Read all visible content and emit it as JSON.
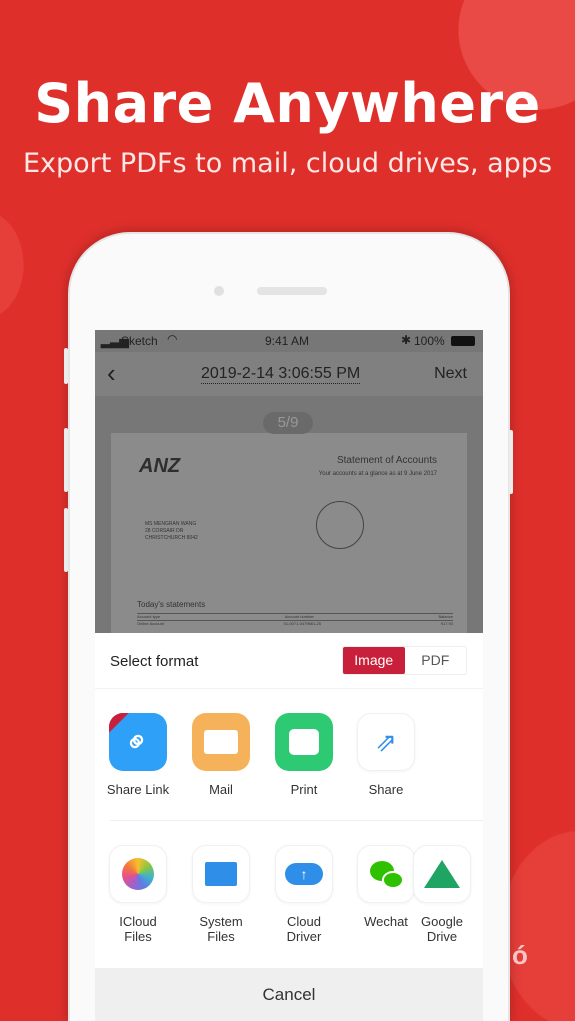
{
  "hero": {
    "title": "Share Anywhere",
    "subtitle": "Export PDFs to mail, cloud drives, apps"
  },
  "status_bar": {
    "carrier": "Sketch",
    "time": "9:41 AM",
    "battery": "100%"
  },
  "nav": {
    "title": "2019-2-14 3:06:55 PM",
    "next": "Next"
  },
  "pager": "5/9",
  "document": {
    "logo": "ANZ",
    "heading": "Statement of Accounts",
    "subheading": "Your accounts at a glance as at 9 June 2017",
    "address": [
      "MS MENGRAN WANG",
      "28 CORSAIR DR",
      "CHRISTCHURCH 8042"
    ],
    "section": "Today's statements",
    "columns": [
      "Account type",
      "Account number",
      "Balance"
    ],
    "row": [
      "Online Account",
      "01-0071-0479661-25",
      "917.93"
    ]
  },
  "sheet": {
    "format_label": "Select format",
    "formats": [
      "Image",
      "PDF"
    ],
    "selected_format": "Image",
    "row1": [
      {
        "label": "Share Link",
        "icon": "link-icon",
        "color": "#2ea0f8"
      },
      {
        "label": "Mail",
        "icon": "mail-icon",
        "color": "#f5b25a"
      },
      {
        "label": "Print",
        "icon": "printer-icon",
        "color": "#2ec973"
      },
      {
        "label": "Share",
        "icon": "share-icon",
        "color": "#2f8fe8"
      }
    ],
    "row2": [
      {
        "l1": "ICloud",
        "l2": "Files",
        "icon": "photos-icon"
      },
      {
        "l1": "System",
        "l2": "Files",
        "icon": "folder-icon"
      },
      {
        "l1": "Cloud",
        "l2": "Driver",
        "icon": "cloud-upload-icon"
      },
      {
        "l1": "Wechat",
        "l2": "",
        "icon": "wechat-icon"
      },
      {
        "l1": "Google",
        "l2": "Drive",
        "icon": "google-drive-icon"
      }
    ],
    "cancel": "Cancel"
  },
  "colors": {
    "background": "#df2f2b",
    "accent": "#c8203a"
  }
}
